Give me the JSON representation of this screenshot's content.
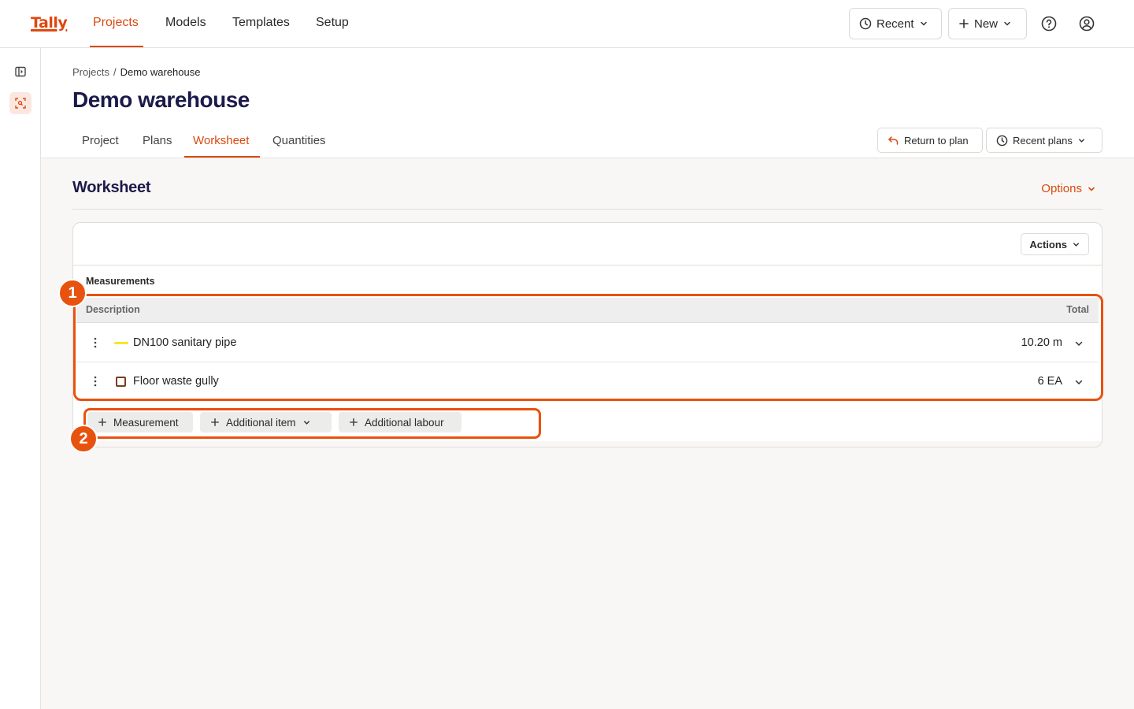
{
  "app": {
    "logo": "Tally"
  },
  "nav": {
    "items": [
      "Projects",
      "Models",
      "Templates",
      "Setup"
    ],
    "recent_label": "Recent",
    "new_label": "New"
  },
  "breadcrumb": {
    "root": "Projects",
    "separator": "/",
    "current": "Demo warehouse"
  },
  "page_title": "Demo warehouse",
  "tabs": [
    "Project",
    "Plans",
    "Worksheet",
    "Quantities"
  ],
  "active_tab": "Worksheet",
  "header_actions": {
    "return_label": "Return to plan",
    "recent_plans_label": "Recent plans"
  },
  "worksheet": {
    "title": "Worksheet",
    "options_label": "Options",
    "actions_label": "Actions",
    "section_label": "Measurements",
    "columns": {
      "description": "Description",
      "total": "Total"
    },
    "rows": [
      {
        "description": "DN100 sanitary pipe",
        "total": "10.20 m",
        "swatch": "line",
        "color": "#f3e82a"
      },
      {
        "description": "Floor waste gully",
        "total": "6 EA",
        "swatch": "box",
        "color": "#7a3e22"
      }
    ],
    "add_buttons": [
      "Measurement",
      "Additional item",
      "Additional labour"
    ]
  },
  "annotations": [
    "1",
    "2"
  ],
  "colors": {
    "accent": "#d94a10",
    "annotation": "#e8520f",
    "title": "#1c1a4a"
  },
  "icons": [
    "clock-icon",
    "plus-icon",
    "chevron-down-icon",
    "help-icon",
    "user-icon",
    "sidebar-toggle-icon",
    "scan-icon",
    "return-arrow-icon",
    "kebab-icon"
  ]
}
